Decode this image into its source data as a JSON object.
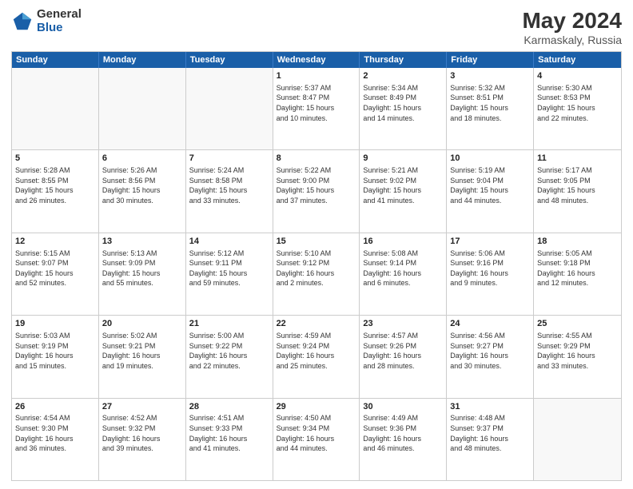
{
  "logo": {
    "general": "General",
    "blue": "Blue"
  },
  "title": "May 2024",
  "subtitle": "Karmaskaly, Russia",
  "header_days": [
    "Sunday",
    "Monday",
    "Tuesday",
    "Wednesday",
    "Thursday",
    "Friday",
    "Saturday"
  ],
  "weeks": [
    [
      {
        "day": "",
        "text": "",
        "empty": true
      },
      {
        "day": "",
        "text": "",
        "empty": true
      },
      {
        "day": "",
        "text": "",
        "empty": true
      },
      {
        "day": "1",
        "text": "Sunrise: 5:37 AM\nSunset: 8:47 PM\nDaylight: 15 hours\nand 10 minutes."
      },
      {
        "day": "2",
        "text": "Sunrise: 5:34 AM\nSunset: 8:49 PM\nDaylight: 15 hours\nand 14 minutes."
      },
      {
        "day": "3",
        "text": "Sunrise: 5:32 AM\nSunset: 8:51 PM\nDaylight: 15 hours\nand 18 minutes."
      },
      {
        "day": "4",
        "text": "Sunrise: 5:30 AM\nSunset: 8:53 PM\nDaylight: 15 hours\nand 22 minutes."
      }
    ],
    [
      {
        "day": "5",
        "text": "Sunrise: 5:28 AM\nSunset: 8:55 PM\nDaylight: 15 hours\nand 26 minutes."
      },
      {
        "day": "6",
        "text": "Sunrise: 5:26 AM\nSunset: 8:56 PM\nDaylight: 15 hours\nand 30 minutes."
      },
      {
        "day": "7",
        "text": "Sunrise: 5:24 AM\nSunset: 8:58 PM\nDaylight: 15 hours\nand 33 minutes."
      },
      {
        "day": "8",
        "text": "Sunrise: 5:22 AM\nSunset: 9:00 PM\nDaylight: 15 hours\nand 37 minutes."
      },
      {
        "day": "9",
        "text": "Sunrise: 5:21 AM\nSunset: 9:02 PM\nDaylight: 15 hours\nand 41 minutes."
      },
      {
        "day": "10",
        "text": "Sunrise: 5:19 AM\nSunset: 9:04 PM\nDaylight: 15 hours\nand 44 minutes."
      },
      {
        "day": "11",
        "text": "Sunrise: 5:17 AM\nSunset: 9:05 PM\nDaylight: 15 hours\nand 48 minutes."
      }
    ],
    [
      {
        "day": "12",
        "text": "Sunrise: 5:15 AM\nSunset: 9:07 PM\nDaylight: 15 hours\nand 52 minutes."
      },
      {
        "day": "13",
        "text": "Sunrise: 5:13 AM\nSunset: 9:09 PM\nDaylight: 15 hours\nand 55 minutes."
      },
      {
        "day": "14",
        "text": "Sunrise: 5:12 AM\nSunset: 9:11 PM\nDaylight: 15 hours\nand 59 minutes."
      },
      {
        "day": "15",
        "text": "Sunrise: 5:10 AM\nSunset: 9:12 PM\nDaylight: 16 hours\nand 2 minutes."
      },
      {
        "day": "16",
        "text": "Sunrise: 5:08 AM\nSunset: 9:14 PM\nDaylight: 16 hours\nand 6 minutes."
      },
      {
        "day": "17",
        "text": "Sunrise: 5:06 AM\nSunset: 9:16 PM\nDaylight: 16 hours\nand 9 minutes."
      },
      {
        "day": "18",
        "text": "Sunrise: 5:05 AM\nSunset: 9:18 PM\nDaylight: 16 hours\nand 12 minutes."
      }
    ],
    [
      {
        "day": "19",
        "text": "Sunrise: 5:03 AM\nSunset: 9:19 PM\nDaylight: 16 hours\nand 15 minutes."
      },
      {
        "day": "20",
        "text": "Sunrise: 5:02 AM\nSunset: 9:21 PM\nDaylight: 16 hours\nand 19 minutes."
      },
      {
        "day": "21",
        "text": "Sunrise: 5:00 AM\nSunset: 9:22 PM\nDaylight: 16 hours\nand 22 minutes."
      },
      {
        "day": "22",
        "text": "Sunrise: 4:59 AM\nSunset: 9:24 PM\nDaylight: 16 hours\nand 25 minutes."
      },
      {
        "day": "23",
        "text": "Sunrise: 4:57 AM\nSunset: 9:26 PM\nDaylight: 16 hours\nand 28 minutes."
      },
      {
        "day": "24",
        "text": "Sunrise: 4:56 AM\nSunset: 9:27 PM\nDaylight: 16 hours\nand 30 minutes."
      },
      {
        "day": "25",
        "text": "Sunrise: 4:55 AM\nSunset: 9:29 PM\nDaylight: 16 hours\nand 33 minutes."
      }
    ],
    [
      {
        "day": "26",
        "text": "Sunrise: 4:54 AM\nSunset: 9:30 PM\nDaylight: 16 hours\nand 36 minutes."
      },
      {
        "day": "27",
        "text": "Sunrise: 4:52 AM\nSunset: 9:32 PM\nDaylight: 16 hours\nand 39 minutes."
      },
      {
        "day": "28",
        "text": "Sunrise: 4:51 AM\nSunset: 9:33 PM\nDaylight: 16 hours\nand 41 minutes."
      },
      {
        "day": "29",
        "text": "Sunrise: 4:50 AM\nSunset: 9:34 PM\nDaylight: 16 hours\nand 44 minutes."
      },
      {
        "day": "30",
        "text": "Sunrise: 4:49 AM\nSunset: 9:36 PM\nDaylight: 16 hours\nand 46 minutes."
      },
      {
        "day": "31",
        "text": "Sunrise: 4:48 AM\nSunset: 9:37 PM\nDaylight: 16 hours\nand 48 minutes."
      },
      {
        "day": "",
        "text": "",
        "empty": true
      }
    ]
  ]
}
